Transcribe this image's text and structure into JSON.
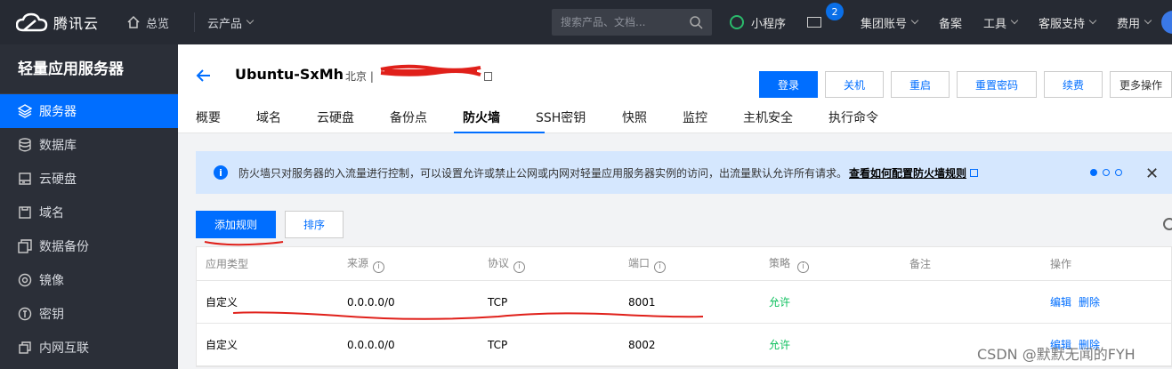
{
  "topbar": {
    "brand": "腾讯云",
    "home": "总览",
    "products": "云产品",
    "search_placeholder": "搜索产品、文档...",
    "mini_program": "小程序",
    "message_count": "2",
    "account": "集团账号",
    "beian": "备案",
    "tools": "工具",
    "support": "客服支持",
    "billing": "费用"
  },
  "sidebar": {
    "title": "轻量应用服务器",
    "items": [
      {
        "label": "服务器",
        "icon": "server-icon",
        "active": true
      },
      {
        "label": "数据库",
        "icon": "database-icon"
      },
      {
        "label": "云硬盘",
        "icon": "disk-icon"
      },
      {
        "label": "域名",
        "icon": "domain-icon"
      },
      {
        "label": "数据备份",
        "icon": "backup-icon"
      },
      {
        "label": "镜像",
        "icon": "image-icon"
      },
      {
        "label": "密钥",
        "icon": "key-icon"
      },
      {
        "label": "内网互联",
        "icon": "network-icon"
      }
    ]
  },
  "header": {
    "instance_name": "Ubuntu-SxMh",
    "region": "北京 |",
    "buttons": [
      "登录",
      "关机",
      "重启",
      "重置密码",
      "续费",
      "更多操作"
    ],
    "tabs": [
      "概要",
      "域名",
      "云硬盘",
      "备份点",
      "防火墙",
      "SSH密钥",
      "快照",
      "监控",
      "主机安全",
      "执行命令"
    ],
    "active_tab": "防火墙"
  },
  "alert": {
    "text": "防火墙只对服务器的入流量进行控制，可以设置允许或禁止公网或内网对轻量应用服务器实例的访问，出流量默认允许所有请求。",
    "link": "查看如何配置防火墙规则"
  },
  "actions": {
    "add_rule": "添加规则",
    "sort": "排序"
  },
  "table": {
    "columns": [
      "应用类型",
      "来源",
      "协议",
      "端口",
      "策略",
      "备注",
      "操作"
    ],
    "rows": [
      {
        "type": "自定义",
        "source": "0.0.0.0/0",
        "protocol": "TCP",
        "port": "8001",
        "policy": "允许",
        "remark": "",
        "edit": "编辑",
        "delete": "删除"
      },
      {
        "type": "自定义",
        "source": "0.0.0.0/0",
        "protocol": "TCP",
        "port": "8002",
        "policy": "允许",
        "remark": "",
        "edit": "编辑",
        "delete": "删除"
      }
    ]
  },
  "watermark": "CSDN @默默无闻的FYH",
  "colors": {
    "primary": "#006eff",
    "topbar": "#262a33",
    "sidebar": "#2b2f38",
    "allow": "#0abf5b",
    "annotation": "#e0201a"
  }
}
